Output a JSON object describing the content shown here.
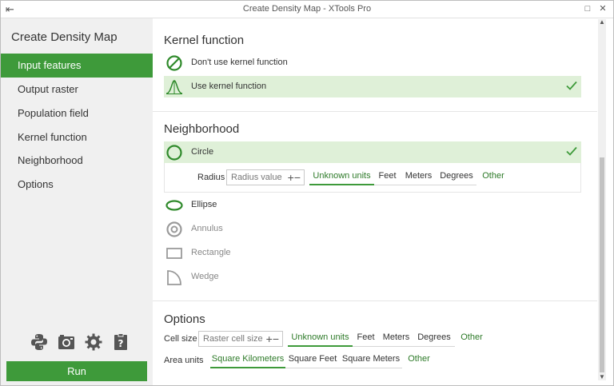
{
  "window": {
    "title": "Create Density Map - XTools Pro"
  },
  "sidebar": {
    "title": "Create Density Map",
    "items": [
      {
        "label": "Input features",
        "active": true
      },
      {
        "label": "Output raster",
        "active": false
      },
      {
        "label": "Population field",
        "active": false
      },
      {
        "label": "Kernel function",
        "active": false
      },
      {
        "label": "Neighborhood",
        "active": false
      },
      {
        "label": "Options",
        "active": false
      }
    ],
    "tool_icons": [
      "python-icon",
      "camera-icon",
      "gear-icon",
      "help-icon"
    ],
    "run_label": "Run"
  },
  "kernel": {
    "title": "Kernel function",
    "options": [
      {
        "label": "Don't use kernel function",
        "icon": "no-kernel-icon",
        "selected": false
      },
      {
        "label": "Use kernel function",
        "icon": "kernel-curve-icon",
        "selected": true
      }
    ]
  },
  "neighborhood": {
    "title": "Neighborhood",
    "selected_label": "Circle",
    "radius": {
      "label": "Radius",
      "placeholder": "Radius value",
      "units": [
        "Unknown units",
        "Feet",
        "Meters",
        "Degrees"
      ],
      "active_unit": "Unknown units",
      "other_label": "Other"
    },
    "shapes": [
      {
        "label": "Ellipse",
        "icon": "ellipse-icon",
        "disabled": false
      },
      {
        "label": "Annulus",
        "icon": "annulus-icon",
        "disabled": true
      },
      {
        "label": "Rectangle",
        "icon": "rectangle-icon",
        "disabled": true
      },
      {
        "label": "Wedge",
        "icon": "wedge-icon",
        "disabled": true
      }
    ]
  },
  "options": {
    "title": "Options",
    "cell_size": {
      "label": "Cell size",
      "placeholder": "Raster cell size",
      "units": [
        "Unknown units",
        "Feet",
        "Meters",
        "Degrees"
      ],
      "active_unit": "Unknown units",
      "other_label": "Other"
    },
    "area_units": {
      "label": "Area units",
      "units": [
        "Square Kilometers",
        "Square Feet",
        "Square Meters"
      ],
      "active_unit": "Square Kilometers",
      "other_label": "Other"
    }
  },
  "colors": {
    "accent": "#3e9a3a",
    "selected_bg": "#dff0d8",
    "sidebar_bg": "#f0f0f0"
  }
}
